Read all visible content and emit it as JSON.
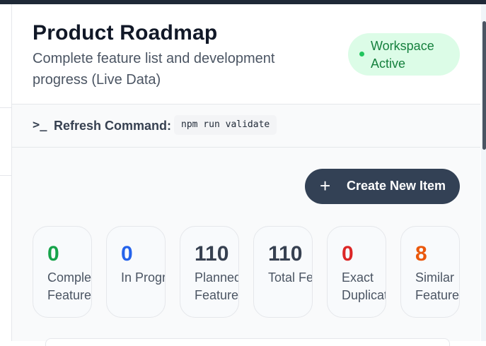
{
  "header": {
    "title": "Product Roadmap",
    "subtitle": "Complete feature list and development progress (Live Data)",
    "status_badge": "Workspace Active"
  },
  "command_bar": {
    "icon": "terminal-prompt-icon",
    "label": "Refresh Command:",
    "command": "npm run validate"
  },
  "actions": {
    "create_icon": "plus-icon",
    "create_label": "Create New Item"
  },
  "stats": [
    {
      "value": "0",
      "label": "Completed Features",
      "color": "#16a34a"
    },
    {
      "value": "0",
      "label": "In Progress",
      "color": "#2563eb"
    },
    {
      "value": "110",
      "label": "Planned Features",
      "color": "#374151"
    },
    {
      "value": "110",
      "label": "Total Features",
      "color": "#374151"
    },
    {
      "value": "0",
      "label": "Exact Duplicates",
      "color": "#dc2626"
    },
    {
      "value": "8",
      "label": "Similar Features",
      "color": "#ea580c"
    }
  ],
  "colors": {
    "accent_button": "#334155",
    "badge_bg": "#dcfce7",
    "badge_text": "#15803d"
  }
}
